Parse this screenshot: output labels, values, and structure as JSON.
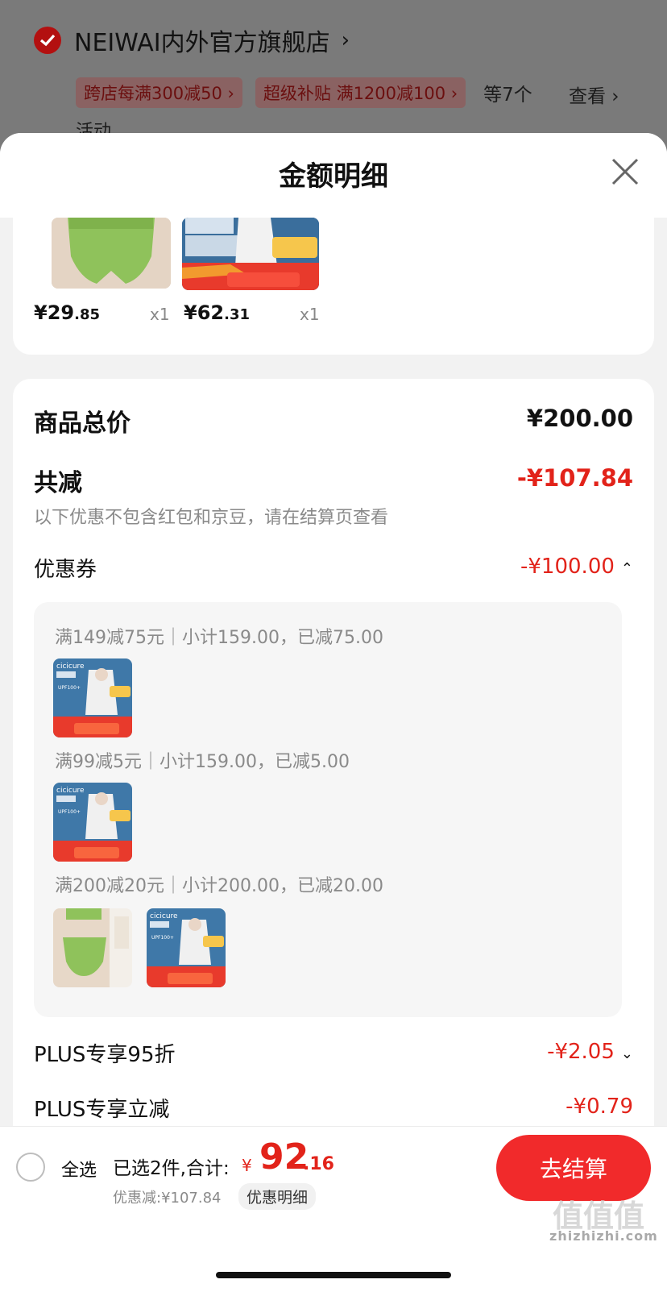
{
  "store": {
    "name": "NEIWAI内外官方旗舰店",
    "promos": [
      "跨店每满300减50 ›",
      "超级补贴 满1200减100 ›"
    ],
    "more": "等7个",
    "view": "查看 ›",
    "activity": "活动"
  },
  "sheet": {
    "title": "金额明细",
    "items": [
      {
        "price_int": "¥29",
        "price_dec": ".85",
        "qty": "x1"
      },
      {
        "price_int": "¥62",
        "price_dec": ".31",
        "qty": "x1"
      }
    ],
    "thumb_text": {
      "b1": "双重接触",
      "b2": "凉感面料",
      "b3": "10CM加宽帽檐",
      "b4": "购物金",
      "b5": "1050",
      "b6": "89",
      "b7": "领券立省70元",
      "b8": "618"
    }
  },
  "summary": {
    "total_label": "商品总价",
    "total_value": "¥200.00",
    "reduce_label": "共减",
    "reduce_value": "-¥107.84",
    "note": "以下优惠不包含红包和京豆，请在结算页查看",
    "coupon_label": "优惠券",
    "coupon_value": "-¥100.00",
    "coupon_lines": [
      "满149减75元｜小计159.00，已减75.00",
      "满99减5元｜小计159.00，已减5.00",
      "满200减20元｜小计200.00，已减20.00"
    ],
    "plus95_label": "PLUS专享95折",
    "plus95_value": "-¥2.05",
    "plus_off_label": "PLUS专享立减",
    "plus_off_value": "-¥0.79",
    "cicicure": "cicicure",
    "upf": "UPF100+"
  },
  "bottom": {
    "select_all": "全选",
    "selected": "已选2件,合计:",
    "yen": "¥",
    "total_int": "92",
    "total_dec": ".16",
    "discount": "优惠减:¥107.84",
    "detail_btn": "优惠明细",
    "checkout": "去结算"
  },
  "watermark": {
    "logo": "值值值",
    "site": "zhizhizhi.com"
  },
  "colors": {
    "accent": "#e2231a",
    "button": "#f12a2b",
    "check": "#b31010"
  }
}
